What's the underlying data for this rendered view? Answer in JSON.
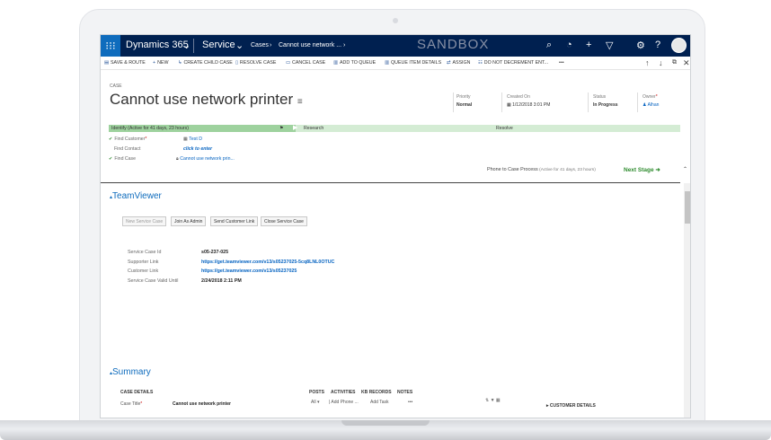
{
  "topbar": {
    "app_name": "Dynamics 365",
    "app_chevron": "⌄",
    "area_name": "Service",
    "area_chevron": "⌄",
    "breadcrumb_entity": "Cases",
    "breadcrumb_sep1": "›",
    "breadcrumb_record": "Cannot use network ...",
    "breadcrumb_sep2": "›",
    "environment": "SANDBOX"
  },
  "commands": [
    {
      "icon": "▤",
      "label": "SAVE & ROUTE"
    },
    {
      "icon": "+",
      "label": "NEW"
    },
    {
      "icon": "↳",
      "label": "CREATE CHILD CASE"
    },
    {
      "icon": "▯",
      "label": "RESOLVE CASE"
    },
    {
      "icon": "▭",
      "label": "CANCEL CASE"
    },
    {
      "icon": "▥",
      "label": "ADD TO QUEUE"
    },
    {
      "icon": "▥",
      "label": "QUEUE ITEM DETAILS"
    },
    {
      "icon": "⇄",
      "label": "ASSIGN"
    },
    {
      "icon": "☷",
      "label": "DO NOT DECREMENT ENT..."
    },
    {
      "icon": "",
      "label": "•••"
    }
  ],
  "record": {
    "entity": "CASE",
    "title": "Cannot use network printer",
    "header_fields": [
      {
        "label": "Priority",
        "value": "Normal"
      },
      {
        "label": "Created On",
        "value": "▦ 1/12/2018  3:01 PM"
      },
      {
        "label": "Status",
        "value": "In Progress"
      },
      {
        "label": "Owner",
        "value": "Alhan"
      }
    ],
    "owner_required": "*"
  },
  "process": {
    "active_stage": "Identify (Active for 41 days, 23 hours)",
    "stages": [
      "Research",
      "Resolve"
    ],
    "steps": [
      {
        "label": "Find Customer",
        "required": "*",
        "value": "Test D",
        "done": true
      },
      {
        "label": "Find Contact",
        "required": "",
        "value": "click to enter",
        "done": false
      },
      {
        "label": "Find Case",
        "required": "",
        "value": "Cannot use network prin...",
        "done": true
      }
    ],
    "check": "✔",
    "footer_name": "Phone to Case Process",
    "footer_duration": "(Active for 41 days, 23 hours)",
    "next_stage": "Next Stage"
  },
  "teamviewer": {
    "title": "TeamViewer",
    "buttons": [
      "New Service Case",
      "Join As Admin",
      "Send Customer Link",
      "Close Service Case"
    ],
    "fields": [
      {
        "label": "Service Case Id",
        "value": "s05-237-025",
        "link": false
      },
      {
        "label": "Supporter Link",
        "value": "https://get.teamviewer.com/v13/s05237025-5cq8LNL0OTUC",
        "link": true
      },
      {
        "label": "Customer Link",
        "value": "https://get.teamviewer.com/v13/s05237025",
        "link": true
      },
      {
        "label": "Service Case Valid Until",
        "value": "2/24/2018   2:11 PM",
        "link": false
      }
    ]
  },
  "summary": {
    "title": "Summary",
    "case_details": "CASE DETAILS",
    "case_title_label": "Case Title",
    "case_title_required": "*",
    "case_title_value": "Cannot use network printer",
    "tabs": [
      "POSTS",
      "ACTIVITIES",
      "KB RECORDS",
      "NOTES"
    ],
    "filter_all": "All",
    "add_phone": "| Add Phone ...",
    "add_task": "Add Task",
    "more": "•••",
    "customer_details": "CUSTOMER DETAILS"
  },
  "colors": {
    "topbar": "#002050",
    "accent": "#0f6cbd",
    "active_stage": "#9ed29e",
    "stage": "#d4ecd4",
    "next_stage": "#2e8b2e"
  }
}
